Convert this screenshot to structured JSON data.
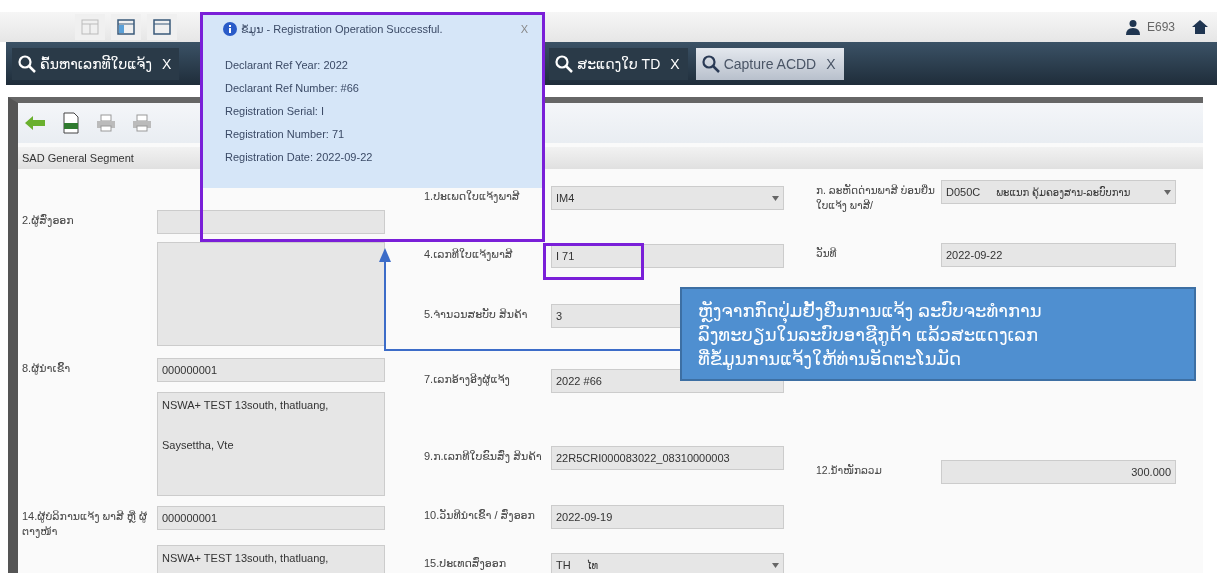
{
  "header": {
    "user": "E693"
  },
  "tabs": [
    {
      "label": "ຄົ້ນຫາເລກທີໃບແຈ້ງ",
      "close": "X",
      "selected": false
    },
    {
      "label": "ສະແດງໃບ TD",
      "close": "X",
      "selected": false
    },
    {
      "label": "Capture ACDD",
      "close": "X",
      "selected": true
    }
  ],
  "section": {
    "title": "SAD General Segment"
  },
  "form": {
    "left": [
      {
        "kind": "input",
        "label": "2.ຜູ້ສົ່ງອອກ"
      },
      {
        "kind": "textarea"
      },
      {
        "kind": "input",
        "label": "8.ຜູ້ນຳເຂົ້າ",
        "value": "000000001"
      },
      {
        "kind": "textarea",
        "value": "NSWA+ TEST 13south, thatluang,\n\nSaysettha, Vte"
      },
      {
        "kind": "input",
        "label": "14.ຜູ້ບໍລິການແຈ້ງ ພາສີ ຫຼື ຜູ້ຕາງໜ້າ",
        "value": "000000001"
      },
      {
        "kind": "textarea",
        "value": "NSWA+ TEST 13south, thatluang,"
      }
    ],
    "middle": [
      {
        "kind": "select",
        "label": "1.ປະເພດໃບແຈ້ງພາສີ",
        "value": "IM4"
      },
      {
        "kind": "input",
        "label": "4.ເລກທີໃບແຈ້ງພາສີ",
        "value": "I 71"
      },
      {
        "kind": "input",
        "label": "5.ຈຳນວນສະບັບ ສິນຄ້າ",
        "value": "3"
      },
      {
        "kind": "input",
        "label": "7.ເລກອ້າງອີງຜູ້ແຈ້ງ",
        "value": "2022 #66"
      },
      {
        "kind": "input",
        "label": "9.ກ.ເລກທີໃບຂົນສົ່ງ ສິນຄ້າ",
        "value": "22R5CRI000083022_08310000003"
      },
      {
        "kind": "input",
        "label": "10.ວັນທີນຳເຂົ້າ / ສົ່ງອອກ",
        "value": "2022-09-19"
      },
      {
        "kind": "select",
        "label": "15.ປະເທດສົ່ງອອກ",
        "value": "TH",
        "extra": "ໄທ"
      }
    ],
    "right": [
      {
        "kind": "select",
        "label": "ກ. ລະຫັດດ່ານພາສີ ບ່ອນຍື່ນໃບແຈ້ງ ພາສີ/",
        "value": "D050C",
        "extra": "ພະແນກ ຄຸ້ມຄອງສານ-ລະບົບການ"
      },
      {
        "kind": "input",
        "label": "ວັນທີ",
        "value": "2022-09-22"
      },
      {
        "kind": "number",
        "label": "12.ນ້ຳໜັກລວມ",
        "value": "300.000"
      }
    ]
  },
  "popup": {
    "title": "ຂໍ້ມູນ - Registration Operation Successful.",
    "close": "X",
    "lines": [
      "Declarant Ref Year:   2022",
      "Declarant Ref Number: #66",
      "Registration Serial: I",
      "Registration Number: 71",
      "Registration Date: 2022-09-22"
    ]
  },
  "callout": {
    "lines": [
      "ຫຼັງຈາກກົດປຸ່ມຢັ້ງຢືນການແຈ້ງ ລະບົບຈະທຳການ",
      "ລົງທະບຽນໃນລະບົບອາຊີກູດ້າ ແລ້ວສະແດງເລກ",
      "ທີ່ຂໍ້ມູນການແຈ້ງໃຫ້ທ່ານອັດຕະໂນມັດ"
    ]
  }
}
